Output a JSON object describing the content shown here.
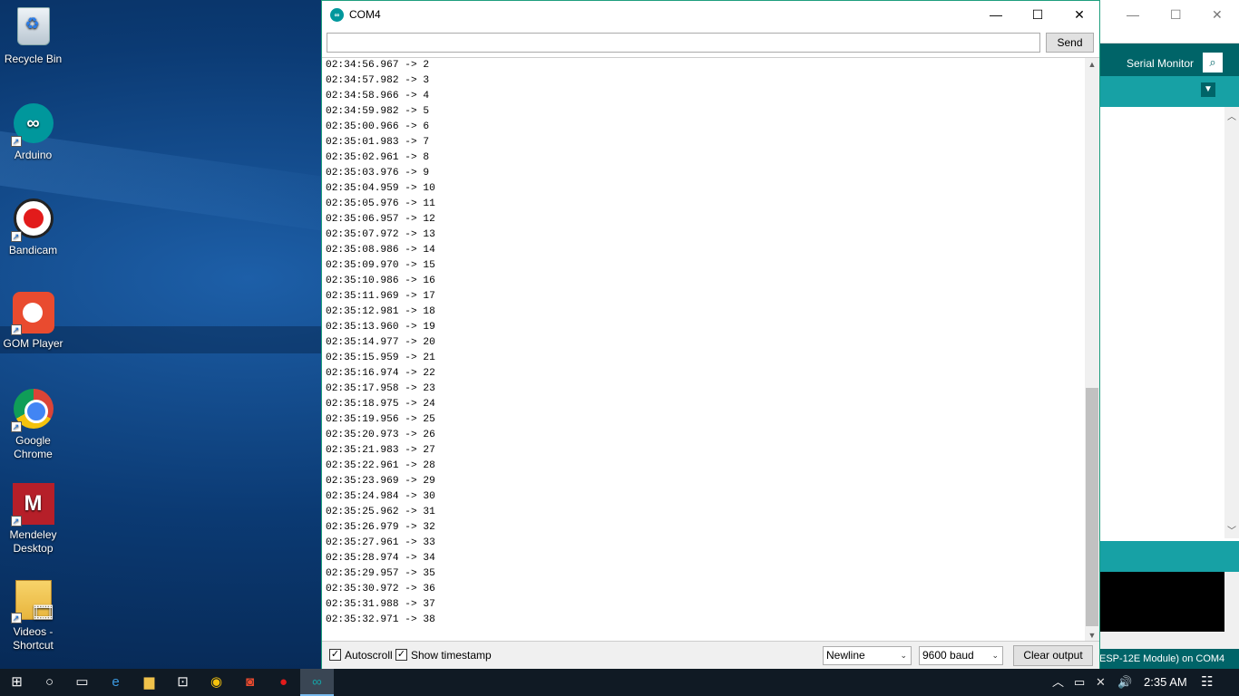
{
  "desktop": {
    "icons": [
      {
        "label": "Recycle Bin",
        "icon": "recycle-bin-icon"
      },
      {
        "label": "Arduino",
        "icon": "arduino-icon"
      },
      {
        "label": "Bandicam",
        "icon": "bandicam-icon"
      },
      {
        "label": "GOM Player",
        "icon": "gom-player-icon"
      },
      {
        "label": "Google Chrome",
        "icon": "chrome-icon"
      },
      {
        "label": "Mendeley Desktop",
        "icon": "mendeley-icon"
      },
      {
        "label": "Videos - Shortcut",
        "icon": "folder-videos-icon"
      }
    ]
  },
  "ide": {
    "serial_monitor_label": "Serial Monitor",
    "footer_text": "ESP-12E Module) on COM4",
    "accent_dark": "#006468",
    "accent_light": "#17a1a5"
  },
  "serial_monitor": {
    "title": "COM4",
    "input_value": "",
    "send_label": "Send",
    "lines": [
      "02:34:56.967 -> 2",
      "02:34:57.982 -> 3",
      "02:34:58.966 -> 4",
      "02:34:59.982 -> 5",
      "02:35:00.966 -> 6",
      "02:35:01.983 -> 7",
      "02:35:02.961 -> 8",
      "02:35:03.976 -> 9",
      "02:35:04.959 -> 10",
      "02:35:05.976 -> 11",
      "02:35:06.957 -> 12",
      "02:35:07.972 -> 13",
      "02:35:08.986 -> 14",
      "02:35:09.970 -> 15",
      "02:35:10.986 -> 16",
      "02:35:11.969 -> 17",
      "02:35:12.981 -> 18",
      "02:35:13.960 -> 19",
      "02:35:14.977 -> 20",
      "02:35:15.959 -> 21",
      "02:35:16.974 -> 22",
      "02:35:17.958 -> 23",
      "02:35:18.975 -> 24",
      "02:35:19.956 -> 25",
      "02:35:20.973 -> 26",
      "02:35:21.983 -> 27",
      "02:35:22.961 -> 28",
      "02:35:23.969 -> 29",
      "02:35:24.984 -> 30",
      "02:35:25.962 -> 31",
      "02:35:26.979 -> 32",
      "02:35:27.961 -> 33",
      "02:35:28.974 -> 34",
      "02:35:29.957 -> 35",
      "02:35:30.972 -> 36",
      "02:35:31.988 -> 37",
      "02:35:32.971 -> 38"
    ],
    "autoscroll_label": "Autoscroll",
    "autoscroll_checked": true,
    "timestamp_label": "Show timestamp",
    "timestamp_checked": true,
    "line_ending": "Newline",
    "baud": "9600 baud",
    "clear_label": "Clear output"
  },
  "taskbar": {
    "clock": "2:35 AM",
    "items": [
      "start-icon",
      "search-icon",
      "task-view-icon",
      "edge-icon",
      "file-explorer-icon",
      "store-icon",
      "chrome-icon",
      "bandicam-icon",
      "record-icon",
      "arduino-icon"
    ]
  }
}
